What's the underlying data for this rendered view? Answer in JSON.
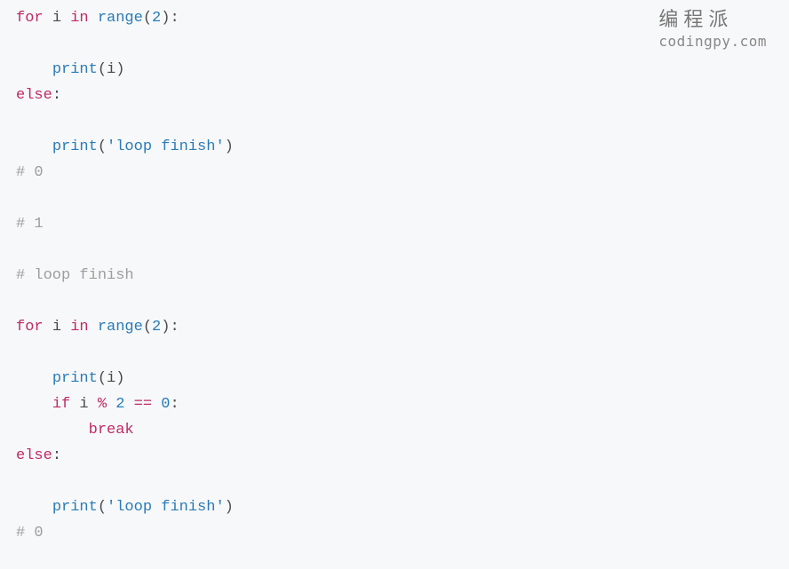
{
  "watermark": {
    "cn": "编程派",
    "en": "codingpy.com"
  },
  "code": {
    "l1": {
      "for": "for",
      "i": "i",
      "in": "in",
      "range": "range",
      "lp": "(",
      "n2": "2",
      "rp": ")",
      "colon": ":"
    },
    "l3": {
      "indent": "    ",
      "print": "print",
      "lp": "(",
      "i": "i",
      "rp": ")"
    },
    "l4": {
      "else": "else",
      "colon": ":"
    },
    "l6": {
      "indent": "    ",
      "print": "print",
      "lp": "(",
      "str": "'loop finish'",
      "rp": ")"
    },
    "l7": {
      "cmt": "# 0"
    },
    "l9": {
      "cmt": "# 1"
    },
    "l11": {
      "cmt": "# loop finish"
    },
    "l13": {
      "for": "for",
      "i": "i",
      "in": "in",
      "range": "range",
      "lp": "(",
      "n2": "2",
      "rp": ")",
      "colon": ":"
    },
    "l15": {
      "indent": "    ",
      "print": "print",
      "lp": "(",
      "i": "i",
      "rp": ")"
    },
    "l16": {
      "indent": "    ",
      "if": "if",
      "i": "i",
      "mod": "%",
      "n2": "2",
      "eq": "==",
      "n0": "0",
      "colon": ":"
    },
    "l17": {
      "indent": "        ",
      "break": "break"
    },
    "l18": {
      "else": "else",
      "colon": ":"
    },
    "l20": {
      "indent": "    ",
      "print": "print",
      "lp": "(",
      "str": "'loop finish'",
      "rp": ")"
    },
    "l21": {
      "cmt": "# 0"
    }
  }
}
